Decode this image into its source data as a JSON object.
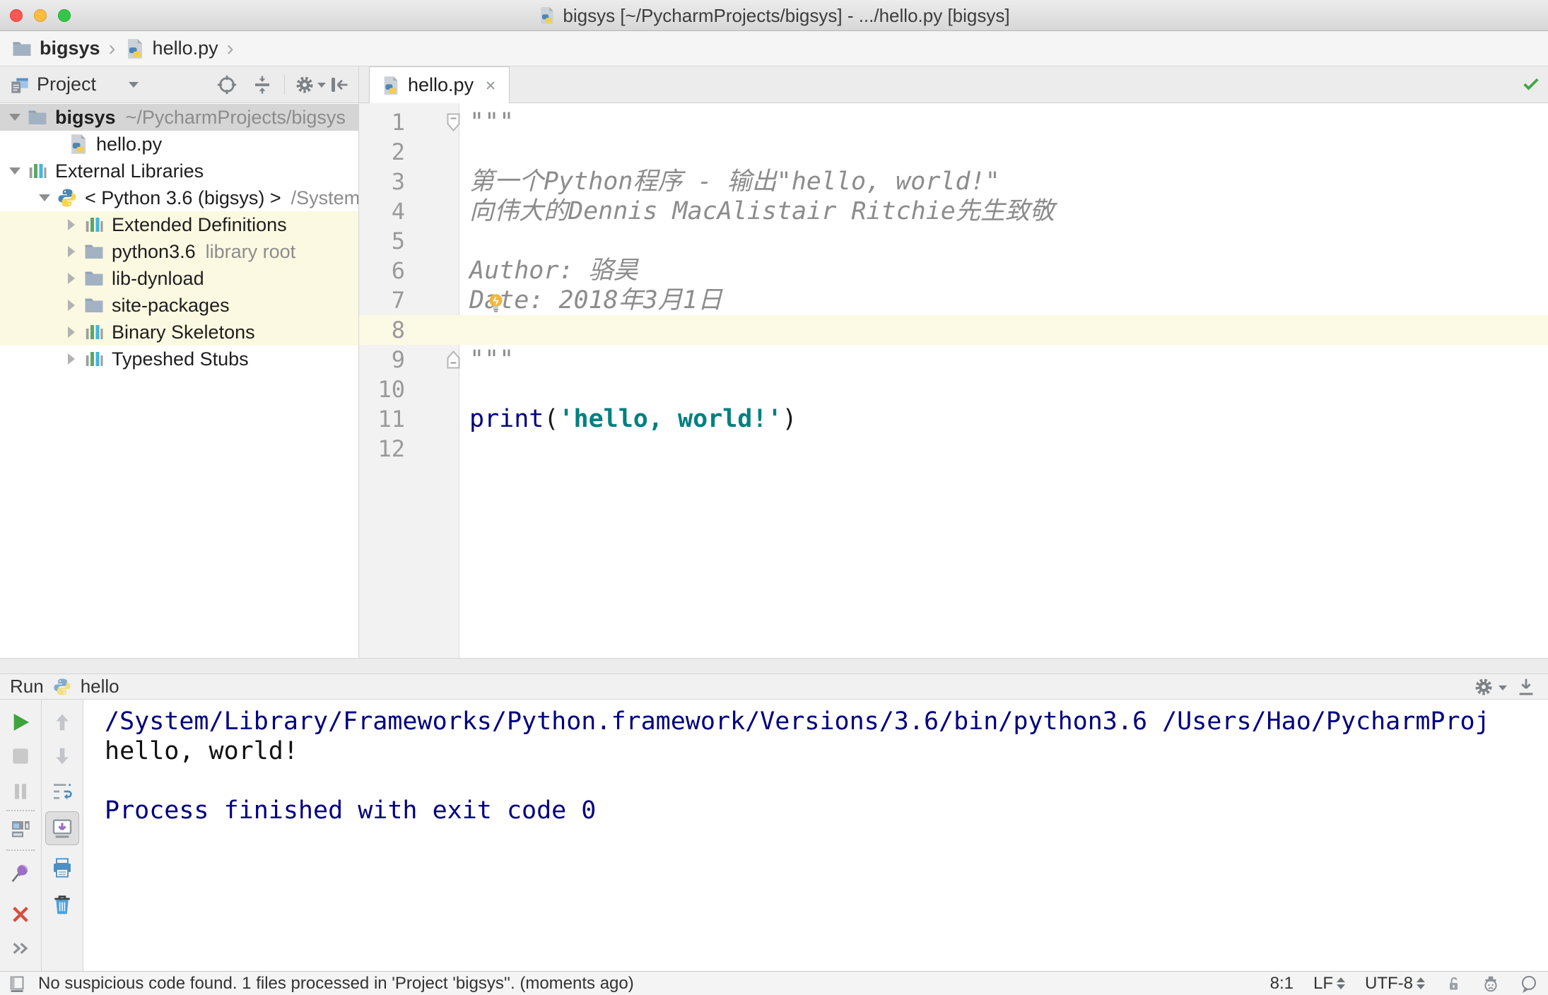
{
  "colors": {
    "accent_green": "#3fa33f",
    "selection_gray": "#d5d5d5",
    "library_row_highlight": "#fbf9e1",
    "current_line_highlight": "#fcf9e4",
    "console_system_blue": "#000080",
    "keyword_navy": "#000080",
    "string_teal": "#008080",
    "docstring_gray": "#8c8c8c"
  },
  "titlebar": {
    "title": "bigsys [~/PycharmProjects/bigsys] - .../hello.py [bigsys]"
  },
  "navbar": {
    "breadcrumbs": [
      {
        "label": "bigsys"
      },
      {
        "label": "hello.py"
      }
    ],
    "run_config": {
      "name": "hello"
    }
  },
  "project_panel": {
    "header": {
      "title": "Project"
    },
    "tree": [
      {
        "indent": 8,
        "arrow": "down",
        "icon": "folder",
        "label": "bigsys",
        "sublabel": "~/PycharmProjects/bigsys",
        "bold": true,
        "selected": true
      },
      {
        "indent": 92,
        "arrow": "none",
        "icon": "pyfile",
        "label": "hello.py"
      },
      {
        "indent": 8,
        "arrow": "down",
        "icon": "library",
        "label": "External Libraries"
      },
      {
        "indent": 50,
        "arrow": "down",
        "icon": "python",
        "label": "< Python 3.6 (bigsys) >",
        "sublabel": "/System"
      },
      {
        "indent": 88,
        "arrow": "right",
        "icon": "library",
        "label": "Extended Definitions",
        "highlighted": true
      },
      {
        "indent": 88,
        "arrow": "right",
        "icon": "folder",
        "label": "python3.6",
        "sublabel": "library root",
        "highlighted": true
      },
      {
        "indent": 88,
        "arrow": "right",
        "icon": "folder",
        "label": "lib-dynload",
        "highlighted": true
      },
      {
        "indent": 88,
        "arrow": "right",
        "icon": "folder",
        "label": "site-packages",
        "highlighted": true
      },
      {
        "indent": 88,
        "arrow": "right",
        "icon": "library",
        "label": "Binary Skeletons",
        "highlighted": true
      },
      {
        "indent": 88,
        "arrow": "right",
        "icon": "library",
        "label": "Typeshed Stubs"
      }
    ]
  },
  "editor": {
    "tab": {
      "label": "hello.py"
    },
    "lines": [
      {
        "num": 1,
        "fold": "start",
        "segs": [
          {
            "t": "\"\"\"",
            "s": "doc"
          }
        ]
      },
      {
        "num": 2,
        "segs": []
      },
      {
        "num": 3,
        "segs": [
          {
            "t": "第一个Python程序 - 输出\"hello, world!\"",
            "s": "doc"
          }
        ]
      },
      {
        "num": 4,
        "segs": [
          {
            "t": "向伟大的Dennis MacAlistair Ritchie先生致敬",
            "s": "doc"
          }
        ]
      },
      {
        "num": 5,
        "segs": []
      },
      {
        "num": 6,
        "segs": [
          {
            "t": "Author: 骆昊",
            "s": "doc"
          }
        ]
      },
      {
        "num": 7,
        "segs": [
          {
            "t": "Date: 2018年3月1日",
            "s": "doc"
          }
        ],
        "bulb": true
      },
      {
        "num": 8,
        "segs": [],
        "current": true
      },
      {
        "num": 9,
        "fold": "end",
        "segs": [
          {
            "t": "\"\"\"",
            "s": "doc"
          }
        ]
      },
      {
        "num": 10,
        "segs": []
      },
      {
        "num": 11,
        "segs": [
          {
            "t": "print",
            "s": "kw"
          },
          {
            "t": "(",
            "s": "plain"
          },
          {
            "t": "'hello, world!'",
            "s": "str"
          },
          {
            "t": ")",
            "s": "plain"
          }
        ]
      },
      {
        "num": 12,
        "segs": []
      }
    ]
  },
  "run_panel": {
    "label": "Run",
    "config_name": "hello",
    "console": [
      {
        "text": "/System/Library/Frameworks/Python.framework/Versions/3.6/bin/python3.6 /Users/Hao/PycharmProj",
        "style": "sys"
      },
      {
        "text": "hello, world!",
        "style": "out"
      },
      {
        "text": "",
        "style": "out"
      },
      {
        "text": "Process finished with exit code 0",
        "style": "sys"
      }
    ]
  },
  "status_bar": {
    "message": "No suspicious code found. 1 files processed in 'Project 'bigsys''. (moments ago)",
    "caret_position": "8:1",
    "line_separator": "LF",
    "encoding": "UTF-8"
  }
}
